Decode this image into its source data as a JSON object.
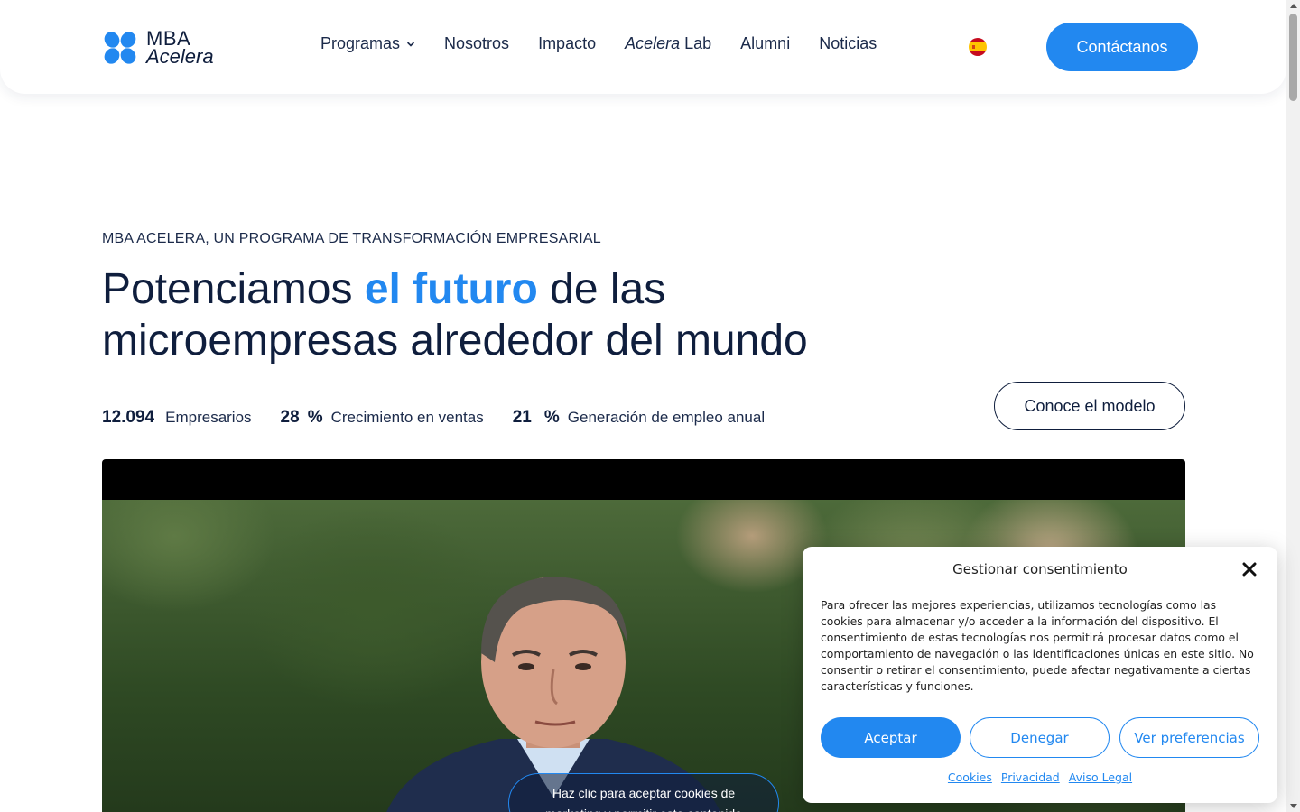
{
  "header": {
    "logo": {
      "line1": "MBA",
      "line2": "Acelera"
    },
    "nav": [
      {
        "label": "Programas",
        "has_dropdown": true
      },
      {
        "label": "Nosotros"
      },
      {
        "label": "Impacto"
      },
      {
        "label_italic": "Acelera",
        "label": "Lab"
      },
      {
        "label": "Alumni"
      },
      {
        "label": "Noticias"
      }
    ],
    "language_flag": "spain-flag-icon",
    "contact_label": "Contáctanos"
  },
  "hero": {
    "eyebrow": "MBA ACELERA, UN PROGRAMA DE TRANSFORMACIÓN EMPRESARIAL",
    "title_part1": "Potenciamos ",
    "title_accent": "el futuro",
    "title_part2": " de las microempresas alrededor del mundo",
    "stats": [
      {
        "value": "12.094",
        "label": "Empresarios"
      },
      {
        "value": "28",
        "unit": "%",
        "label": "Crecimiento en ventas"
      },
      {
        "value": "21",
        "unit": "%",
        "label": "Generación de empleo anual"
      }
    ],
    "model_button": "Conoce el modelo"
  },
  "video": {
    "cta": "Haz clic para aceptar cookies de marketing y permitir este contenido"
  },
  "cookie_banner": {
    "title": "Gestionar consentimiento",
    "text": "Para ofrecer las mejores experiencias, utilizamos tecnologías como las cookies para almacenar y/o acceder a la información del dispositivo. El consentimiento de estas tecnologías nos permitirá procesar datos como el comportamiento de navegación o las identificaciones únicas en este sitio. No consentir o retirar el consentimiento, puede afectar negativamente a ciertas características y funciones.",
    "accept": "Aceptar",
    "deny": "Denegar",
    "preferences": "Ver preferencias",
    "links": [
      "Cookies",
      "Privacidad",
      "Aviso Legal"
    ]
  },
  "colors": {
    "accent": "#2288f0",
    "navy": "#0f1e3d"
  }
}
